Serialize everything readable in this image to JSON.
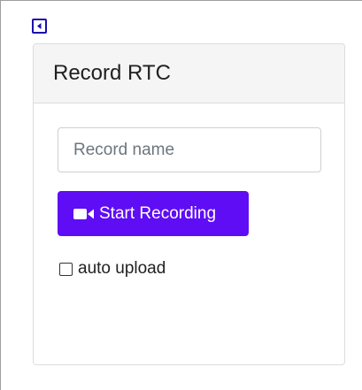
{
  "toggle": {
    "icon": "caret-left-icon",
    "color": "#1a0dab"
  },
  "card": {
    "title": "Record RTC"
  },
  "form": {
    "record_name": {
      "value": "",
      "placeholder": "Record name"
    },
    "start_button": {
      "label": "Start Recording",
      "icon": "video-camera-icon",
      "color": "#5f0df5"
    },
    "auto_upload": {
      "label": "auto upload",
      "checked": false
    }
  }
}
